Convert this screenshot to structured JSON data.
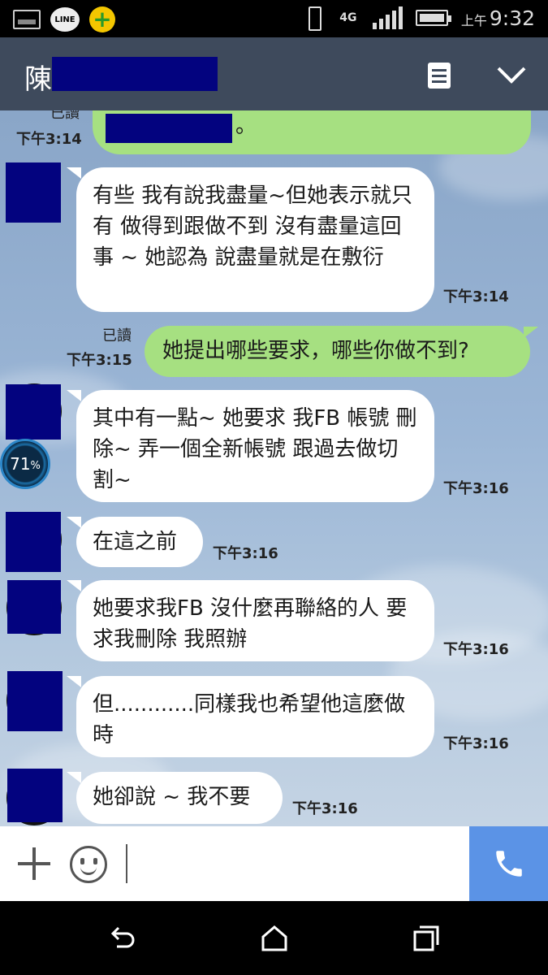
{
  "status_bar": {
    "icons": [
      "gallery-icon",
      "line-app-icon",
      "plus-app-icon"
    ],
    "line_label": "LINE",
    "network": "4G",
    "time_prefix": "上午",
    "time": "9:32"
  },
  "header": {
    "title": "陳",
    "icons": [
      "note-icon",
      "chevron-down-icon"
    ]
  },
  "messages": [
    {
      "dir": "out",
      "text": "。",
      "read": "已讀",
      "time": "下午3:14"
    },
    {
      "dir": "in",
      "text": "有些 我有說我盡量~但她表示就只有 做得到跟做不到 沒有盡量這回事 ~ 她認為 說盡量就是在敷衍",
      "time": "下午3:14"
    },
    {
      "dir": "out",
      "text": "她提出哪些要求，哪些你做不到?",
      "read": "已讀",
      "time": "下午3:15"
    },
    {
      "dir": "in",
      "text": "其中有一點~ 她要求 我FB 帳號 刪除~ 弄一個全新帳號 跟過去做切割~",
      "time": "下午3:16"
    },
    {
      "dir": "in",
      "text": "在這之前",
      "time": "下午3:16"
    },
    {
      "dir": "in",
      "text": "她要求我FB 沒什麼再聯絡的人 要求我刪除 我照辦",
      "time": "下午3:16"
    },
    {
      "dir": "in",
      "text": "但............同樣我也希望他這麼做時",
      "time": "下午3:16"
    },
    {
      "dir": "in",
      "text": "她卻說 ~ 我不要",
      "time": "下午3:16"
    }
  ],
  "overlay_gauge": {
    "value": "71",
    "unit": "%"
  },
  "input_bar": {
    "icons": [
      "plus-icon",
      "emoji-icon",
      "phone-icon"
    ],
    "value": ""
  },
  "nav_bar": {
    "icons": [
      "back-icon",
      "home-icon",
      "recents-icon"
    ]
  },
  "colors": {
    "header_bg": "#3e4a5c",
    "outgoing_bubble": "#a6e081",
    "incoming_bubble": "#ffffff",
    "call_button": "#5b93e6",
    "redaction": "#03037f"
  }
}
